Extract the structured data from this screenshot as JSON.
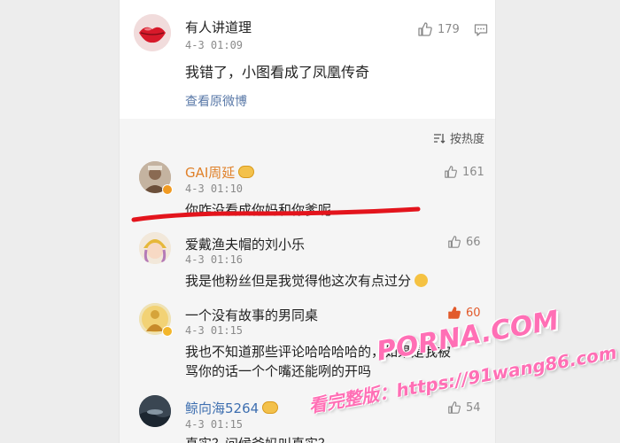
{
  "main_comment": {
    "user": "有人讲道理",
    "time": "4-3 01:09",
    "likes": "179",
    "text": "我错了，小图看成了凤凰传奇",
    "view_original": "查看原微博"
  },
  "sort_label": "按热度",
  "replies": [
    {
      "user": "GAI周延",
      "time": "4-3 01:10",
      "likes": "161",
      "text": "你咋没看成你妈和你爹呢"
    },
    {
      "user": "爱戴渔夫帽的刘小乐",
      "time": "4-3 01:16",
      "likes": "66",
      "text": "我是他粉丝但是我觉得他这次有点过分"
    },
    {
      "user": "一个没有故事的男同桌",
      "time": "4-3 01:15",
      "likes": "60",
      "text_line1": "我也不知道那些评论哈哈哈哈的，如果是我被",
      "text_line2": "骂你的话一个个嘴还能咧的开吗"
    },
    {
      "user": "鲸向海5264",
      "time": "4-3 01:15",
      "likes": "54",
      "text": "真实？问候爸妈叫真实？"
    }
  ],
  "watermark": {
    "logo": "PORNA.COM",
    "url": "看完整版：https://91wang86.com"
  },
  "colors": {
    "hot_like": "#e25a2b",
    "gold_name": "#e0812a",
    "blue_name": "#3e6fb0",
    "link": "#5a79a8",
    "red_underline": "#e3141c",
    "watermark": "#ff6fb5"
  }
}
